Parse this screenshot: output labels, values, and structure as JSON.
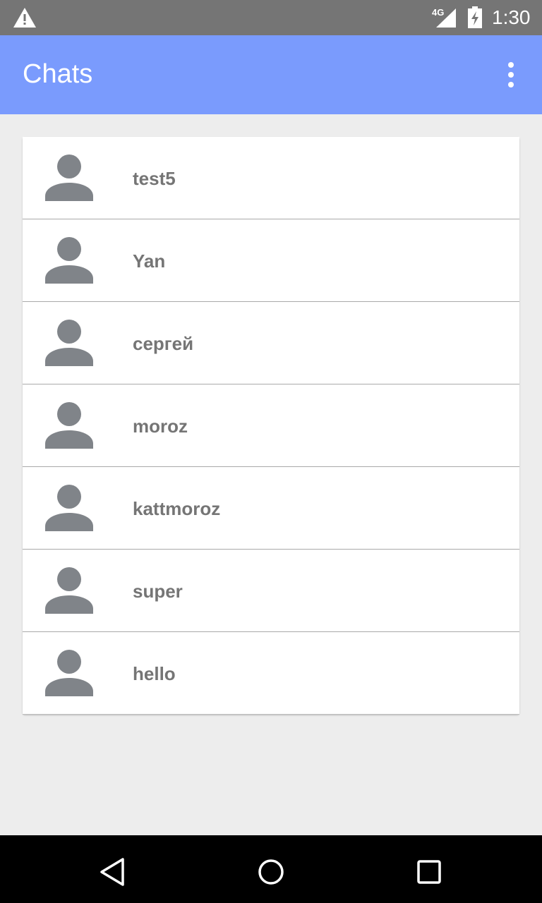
{
  "status_bar": {
    "network_label": "4G",
    "time": "1:30"
  },
  "app_bar": {
    "title": "Chats",
    "menu_icon": "more-vert-icon"
  },
  "chats": [
    {
      "name": "test5",
      "icon": "person-icon"
    },
    {
      "name": "Yan",
      "icon": "person-icon"
    },
    {
      "name": "сергей",
      "icon": "person-icon"
    },
    {
      "name": "moroz",
      "icon": "person-icon"
    },
    {
      "name": "kattmoroz",
      "icon": "person-icon"
    },
    {
      "name": "super",
      "icon": "person-icon"
    },
    {
      "name": "hello",
      "icon": "person-icon"
    }
  ],
  "nav_bar": {
    "back_icon": "back-icon",
    "home_icon": "home-icon",
    "recents_icon": "recents-icon"
  },
  "colors": {
    "app_bar": "#7a9bfd",
    "status_bar": "#757575",
    "background": "#ededed",
    "avatar": "#808489",
    "name_text": "#757575"
  }
}
